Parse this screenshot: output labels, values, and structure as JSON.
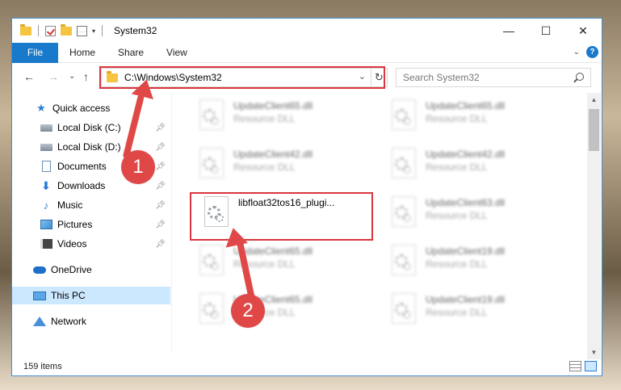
{
  "window": {
    "title": "System32",
    "controls": {
      "minimize": "—",
      "maximize": "☐",
      "close": "✕"
    }
  },
  "ribbon": {
    "tabs": [
      "File",
      "Home",
      "Share",
      "View"
    ],
    "expand": "⌄",
    "help": "?"
  },
  "address": {
    "path": "C:\\Windows\\System32",
    "search_placeholder": "Search System32"
  },
  "nav": {
    "back": "←",
    "forward": "→",
    "recent": "⌄",
    "up": "↑"
  },
  "sidebar": {
    "items": [
      {
        "label": "Quick access",
        "icon": "star-icon"
      },
      {
        "label": "Local Disk (C:)",
        "icon": "disk-icon",
        "pinned": true
      },
      {
        "label": "Local Disk (D:)",
        "icon": "disk-icon",
        "pinned": true
      },
      {
        "label": "Documents",
        "icon": "document-icon",
        "pinned": true
      },
      {
        "label": "Downloads",
        "icon": "download-icon",
        "pinned": true
      },
      {
        "label": "Music",
        "icon": "music-icon",
        "pinned": true
      },
      {
        "label": "Pictures",
        "icon": "pictures-icon",
        "pinned": true
      },
      {
        "label": "Videos",
        "icon": "videos-icon",
        "pinned": true
      },
      {
        "label": "OneDrive",
        "icon": "onedrive-icon"
      },
      {
        "label": "This PC",
        "icon": "this-pc-icon",
        "selected": true
      },
      {
        "label": "Network",
        "icon": "network-icon"
      }
    ]
  },
  "files": [
    {
      "name": "UpdateClient65.dll",
      "type": "Resource DLL"
    },
    {
      "name": "UpdateClient65.dll",
      "type": "Resource DLL"
    },
    {
      "name": "UpdateClient42.dll",
      "type": "Resource DLL"
    },
    {
      "name": "UpdateClient42.dll",
      "type": "Resource DLL"
    },
    {
      "name": "libfloat32tos16_plugi...",
      "type": ""
    },
    {
      "name": "UpdateClient63.dll",
      "type": "Resource DLL"
    },
    {
      "name": "UpdateClient65.dll",
      "type": "Resource DLL"
    },
    {
      "name": "UpdateClient19.dll",
      "type": "Resource DLL"
    },
    {
      "name": "UpdateClient65.dll",
      "type": "Resource DLL"
    },
    {
      "name": "UpdateClient19.dll",
      "type": "Resource DLL"
    }
  ],
  "status": {
    "item_count": "159 items"
  },
  "annotations": {
    "step1": "1",
    "step2": "2",
    "color": "#e04848"
  }
}
